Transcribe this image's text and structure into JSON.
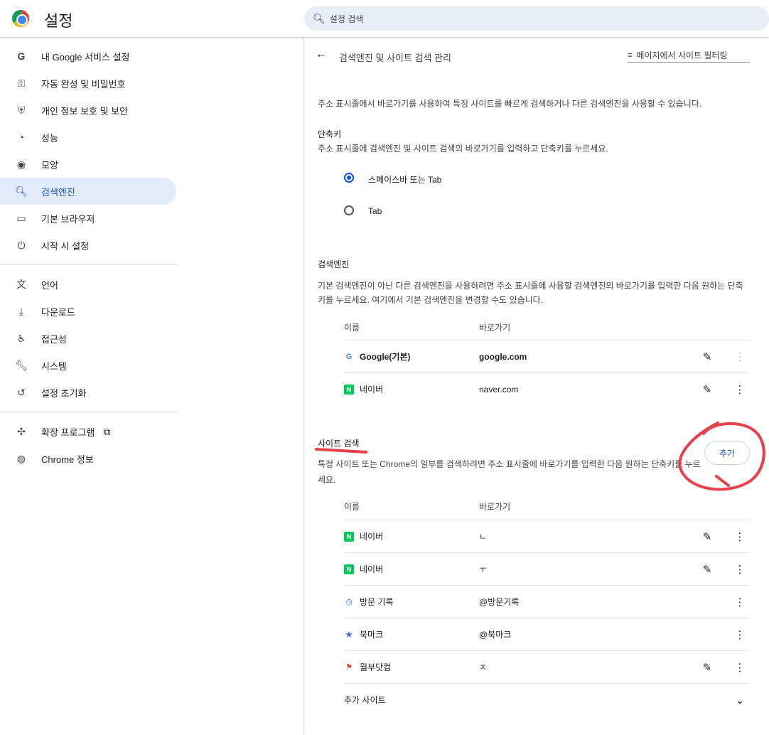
{
  "header": {
    "title": "설정",
    "search_placeholder": "설정 검색"
  },
  "sidebar": {
    "items": [
      {
        "label": "내 Google 서비스 설정",
        "icon": "G"
      },
      {
        "label": "자동 완성 및 비밀번호",
        "icon": "⚿"
      },
      {
        "label": "개인 정보 보호 및 보안",
        "icon": "⛨"
      },
      {
        "label": "성능",
        "icon": "◔"
      },
      {
        "label": "모양",
        "icon": "◉"
      },
      {
        "label": "검색엔진",
        "icon": "🔍︎"
      },
      {
        "label": "기본 브라우저",
        "icon": "▭"
      },
      {
        "label": "시작 시 설정",
        "icon": "⏻"
      },
      {
        "label": "언어",
        "icon": "文"
      },
      {
        "label": "다운로드",
        "icon": "⤓"
      },
      {
        "label": "접근성",
        "icon": "♿︎"
      },
      {
        "label": "시스템",
        "icon": "🔧︎"
      },
      {
        "label": "설정 초기화",
        "icon": "↺"
      },
      {
        "label": "확장 프로그램",
        "icon": "✣"
      },
      {
        "label": "Chrome 정보",
        "icon": "◍"
      }
    ]
  },
  "main": {
    "title": "검색엔진 및 사이트 검색 관리",
    "filter_placeholder": "페이지에서 사이트 필터링",
    "intro": "주소 표시줄에서 바로가기를 사용하여 특정 사이트를 빠르게 검색하거나 다른 검색엔진을 사용할 수 있습니다.",
    "shortcut": {
      "heading": "단축키",
      "desc": "주소 표시줄에 검색엔진 및 사이트 검색의 바로가기를 입력하고 단축키를 누르세요.",
      "options": [
        "스페이스바 또는 Tab",
        "Tab"
      ],
      "selected": 0
    },
    "engines": {
      "heading": "검색엔진",
      "desc": "기본 검색엔진이 아닌 다른 검색엔진을 사용하려면 주소 표시줄에 사용할 검색엔진의 바로가기를 입력한 다음 원하는 단축키를 누르세요. 여기에서 기본 검색엔진을 변경할 수도 있습니다.",
      "col_name": "이름",
      "col_shortcut": "바로가기",
      "rows": [
        {
          "name": "Google(기본)",
          "shortcut": "google.com"
        },
        {
          "name": "네이버",
          "shortcut": "naver.com"
        }
      ]
    },
    "sites": {
      "heading": "사이트 검색",
      "add_label": "추가",
      "desc": "특정 사이트 또는 Chrome의 일부를 검색하려면 주소 표시줄에 바로가기를 입력한 다음 원하는 단축키를 누르세요.",
      "col_name": "이름",
      "col_shortcut": "바로가기",
      "rows": [
        {
          "name": "네이버",
          "shortcut": "ㄴ"
        },
        {
          "name": "네이버",
          "shortcut": "ㅜ"
        },
        {
          "name": "방문 기록",
          "shortcut": "@방문기록"
        },
        {
          "name": "북마크",
          "shortcut": "@북마크"
        },
        {
          "name": "월부닷컴",
          "shortcut": "ㅈ"
        }
      ],
      "more_label": "추가 사이트"
    }
  },
  "colors": {
    "accent": "#0b57d0",
    "annotation": "#e8404a"
  }
}
